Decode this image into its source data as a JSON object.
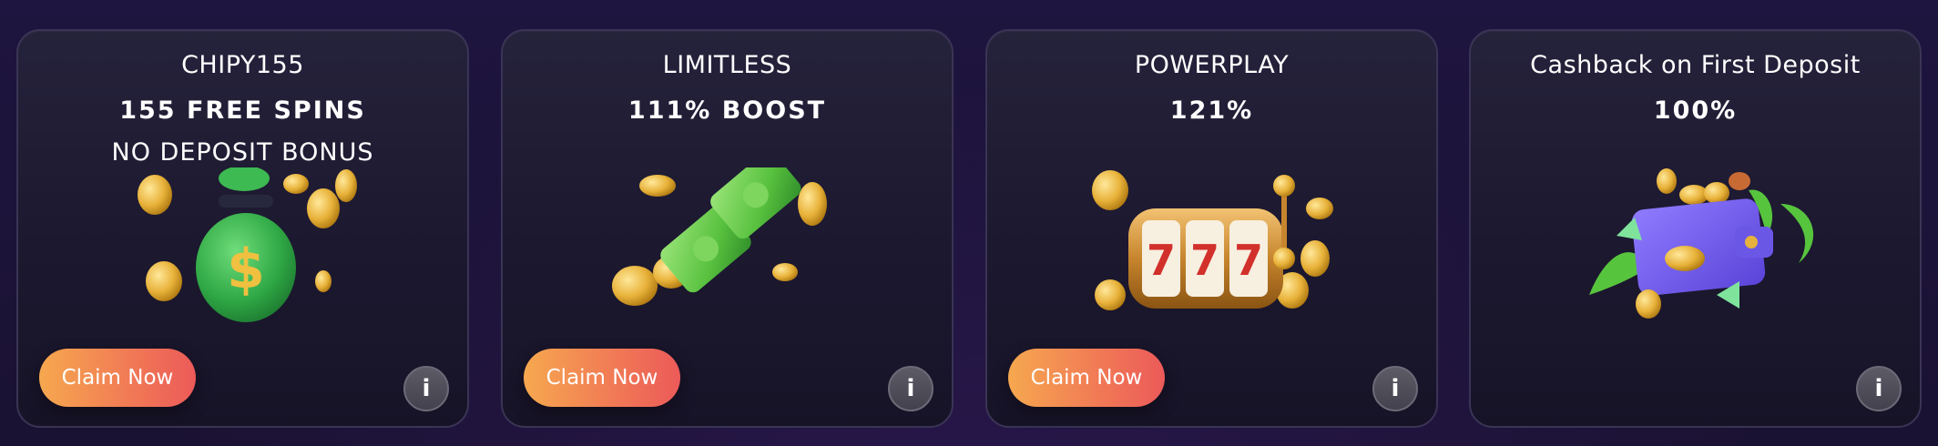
{
  "cards": [
    {
      "title": "CHIPY155",
      "headline": "155 FREE SPINS",
      "subline": "NO DEPOSIT BONUS",
      "illustration": "money-bag-icon",
      "claim_label": "Claim Now",
      "info_label": "i"
    },
    {
      "title": "LIMITLESS",
      "headline": "111% BOOST",
      "subline": "",
      "illustration": "cash-stack-icon",
      "claim_label": "Claim Now",
      "info_label": "i"
    },
    {
      "title": "POWERPLAY",
      "headline": "121%",
      "subline": "",
      "illustration": "slot-machine-icon",
      "claim_label": "Claim Now",
      "info_label": "i"
    },
    {
      "title": "Cashback on First Deposit",
      "headline": "100%",
      "subline": "",
      "illustration": "wallet-cashback-icon",
      "claim_label": "",
      "info_label": "i"
    }
  ],
  "colors": {
    "background": "#1b1434",
    "card": "#1c182f",
    "button_start": "#f6a84f",
    "button_end": "#ec5a59"
  }
}
